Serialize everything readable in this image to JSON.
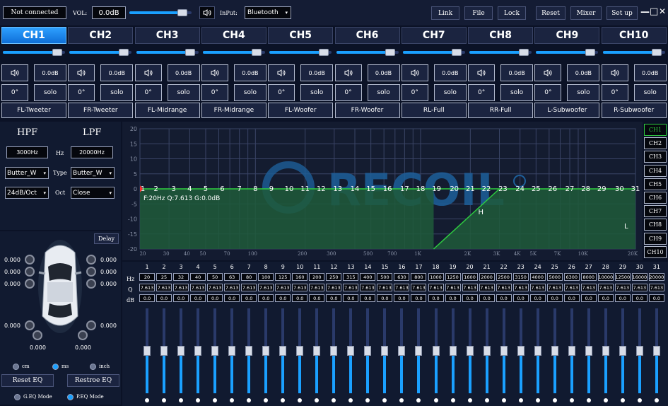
{
  "topbar": {
    "status": "Not connected",
    "vol_label": "VOL:",
    "vol_value": "0.0dB",
    "volume_level": 0.93,
    "input_label": "InPut:",
    "input_value": "Bluetooth",
    "buttons": [
      "Link",
      "File",
      "Lock",
      "Reset",
      "Mixer",
      "Set up"
    ],
    "window_controls": [
      "—",
      "□",
      "✕"
    ]
  },
  "channels": [
    {
      "name": "CH1",
      "gain": "0.0dB",
      "phase": "0°",
      "solo": "solo",
      "label": "FL-Tweeter",
      "level": 0.95,
      "active": true
    },
    {
      "name": "CH2",
      "gain": "0.0dB",
      "phase": "0°",
      "solo": "solo",
      "label": "FR-Tweeter",
      "level": 0.95,
      "active": false
    },
    {
      "name": "CH3",
      "gain": "0.0dB",
      "phase": "0°",
      "solo": "solo",
      "label": "FL-Midrange",
      "level": 0.95,
      "active": false
    },
    {
      "name": "CH4",
      "gain": "0.0dB",
      "phase": "0°",
      "solo": "solo",
      "label": "FR-Midrange",
      "level": 0.95,
      "active": false
    },
    {
      "name": "CH5",
      "gain": "0.0dB",
      "phase": "0°",
      "solo": "solo",
      "label": "FL-Woofer",
      "level": 0.95,
      "active": false
    },
    {
      "name": "CH6",
      "gain": "0.0dB",
      "phase": "0°",
      "solo": "solo",
      "label": "FR-Woofer",
      "level": 0.95,
      "active": false
    },
    {
      "name": "CH7",
      "gain": "0.0dB",
      "phase": "0°",
      "solo": "solo",
      "label": "RL-Full",
      "level": 0.95,
      "active": false
    },
    {
      "name": "CH8",
      "gain": "0.0dB",
      "phase": "0°",
      "solo": "solo",
      "label": "RR-Full",
      "level": 0.95,
      "active": false
    },
    {
      "name": "CH9",
      "gain": "0.0dB",
      "phase": "0°",
      "solo": "solo",
      "label": "L-Subwoofer",
      "level": 0.95,
      "active": false
    },
    {
      "name": "CH10",
      "gain": "0.0dB",
      "phase": "0°",
      "solo": "solo",
      "label": "R-Subwoofer",
      "level": 0.95,
      "active": false
    }
  ],
  "filters": {
    "hpf_title": "HPF",
    "lpf_title": "LPF",
    "hpf_freq": "3000Hz",
    "hz_label": "Hz",
    "lpf_freq": "20000Hz",
    "hpf_type": "Butter_W",
    "type_label": "Type",
    "lpf_type": "Butter_W",
    "hpf_slope": "24dB/Oct",
    "oct_label": "Oct",
    "lpf_slope": "Close"
  },
  "delay": {
    "button": "Delay",
    "left_values": [
      "0.000",
      "0.000",
      "0.000",
      "0.000"
    ],
    "right_values": [
      "0.000",
      "0.000",
      "0.000",
      "0.000"
    ],
    "bottom_values": [
      "0.000",
      "0.000"
    ],
    "units": [
      "cm",
      "ms",
      "inch"
    ],
    "selected_unit": "ms",
    "reset_eq": "Reset EQ",
    "restore_eq": "Restroe EQ",
    "modes": [
      "G.EQ Mode",
      "P.EQ Mode"
    ],
    "selected_mode": "P.EQ Mode"
  },
  "graph": {
    "readout": "F:20Hz Q:7.613 G:0.0dB",
    "y_ticks": [
      "20",
      "15",
      "10",
      "5",
      "0",
      "-5",
      "-10",
      "-15",
      "-20"
    ],
    "x_ticks": [
      "20",
      "30",
      "40",
      "50",
      "70",
      "100",
      "200",
      "300",
      "500",
      "700",
      "1K",
      "2K",
      "3K",
      "4K",
      "5K",
      "7K",
      "10K",
      "20K"
    ],
    "point_labels": [
      "1",
      "2",
      "3",
      "4",
      "5",
      "6",
      "7",
      "8",
      "9",
      "10",
      "11",
      "12",
      "13",
      "14",
      "15",
      "16",
      "17",
      "18",
      "19",
      "20",
      "21",
      "22",
      "23",
      "24",
      "25",
      "26",
      "27",
      "28",
      "29",
      "30",
      "31"
    ],
    "h_marker": "H",
    "l_marker": "L",
    "logo_text": "RECOIL",
    "hpf_hz": 3000,
    "lpf_hz": 20000
  },
  "channel_list": [
    "CH1",
    "CH2",
    "CH3",
    "CH4",
    "CH5",
    "CH6",
    "CH7",
    "CH8",
    "CH9",
    "CH10"
  ],
  "eq": {
    "row_labels": [
      "Hz",
      "Q",
      "dB"
    ],
    "bands": [
      "1",
      "2",
      "3",
      "4",
      "5",
      "6",
      "7",
      "8",
      "9",
      "10",
      "11",
      "12",
      "13",
      "14",
      "15",
      "16",
      "17",
      "18",
      "19",
      "20",
      "21",
      "22",
      "23",
      "24",
      "25",
      "26",
      "27",
      "28",
      "29",
      "30",
      "31"
    ],
    "freqs": [
      "20",
      "25",
      "32",
      "40",
      "50",
      "63",
      "80",
      "100",
      "125",
      "160",
      "200",
      "250",
      "315",
      "400",
      "500",
      "630",
      "800",
      "1000",
      "1250",
      "1600",
      "2000",
      "2500",
      "3150",
      "4000",
      "5000",
      "6300",
      "8000",
      "10000",
      "12500",
      "16000",
      "20000"
    ],
    "q": "7.613",
    "db": "0.0",
    "slider_level": 0.5
  },
  "colors": {
    "accent": "#1aa0ff",
    "curve": "#2ecc40",
    "fill": "#1f5a3a"
  }
}
